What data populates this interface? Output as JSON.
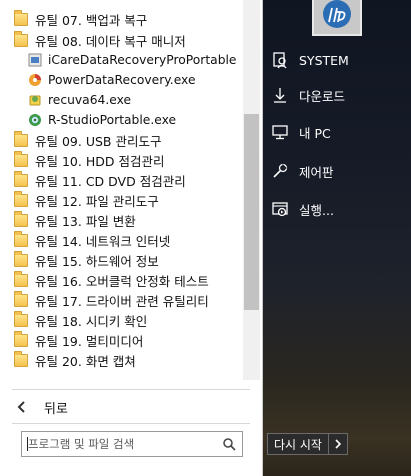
{
  "programs": [
    {
      "label": "유틸 07. 백업과 복구",
      "type": "folder"
    },
    {
      "label": "유틸 08. 데이타 복구 매니저",
      "type": "folder"
    },
    {
      "label": "iCareDataRecoveryProPortable",
      "type": "app",
      "icon": "icare-icon"
    },
    {
      "label": "PowerDataRecovery.exe",
      "type": "app",
      "icon": "powerdata-icon"
    },
    {
      "label": "recuva64.exe",
      "type": "app",
      "icon": "recuva-icon"
    },
    {
      "label": "R-StudioPortable.exe",
      "type": "app",
      "icon": "rstudio-icon"
    },
    {
      "label": "유틸 09. USB 관리도구",
      "type": "folder"
    },
    {
      "label": "유틸 10. HDD 점검관리",
      "type": "folder"
    },
    {
      "label": "유틸 11. CD DVD 점검관리",
      "type": "folder"
    },
    {
      "label": "유틸 12. 파일 관리도구",
      "type": "folder"
    },
    {
      "label": "유틸 13. 파일 변환",
      "type": "folder"
    },
    {
      "label": "유틸 14. 네트워크 인터넷",
      "type": "folder"
    },
    {
      "label": "유틸 15. 하드웨어 정보",
      "type": "folder"
    },
    {
      "label": "유틸 16. 오버클럭 안정화 테스트",
      "type": "folder"
    },
    {
      "label": "유틸 17. 드라이버 관련 유틸리티",
      "type": "folder"
    },
    {
      "label": "유틸 18. 시디키 확인",
      "type": "folder"
    },
    {
      "label": "유틸 19. 멀티미디어",
      "type": "folder"
    },
    {
      "label": "유틸 20. 화면 캡쳐",
      "type": "folder"
    }
  ],
  "back_label": "뒤로",
  "search": {
    "placeholder": "프로그램 및 파일 검색"
  },
  "right_menu": [
    {
      "label": "SYSTEM",
      "icon": "user-icon"
    },
    {
      "label": "다운로드",
      "icon": "download-icon"
    },
    {
      "label": "내 PC",
      "icon": "computer-icon"
    },
    {
      "label": "제어판",
      "icon": "wrench-icon"
    },
    {
      "label": "실행...",
      "icon": "run-icon"
    }
  ],
  "shutdown_label": "다시 시작",
  "colors": {
    "accent": "#1f6fb2",
    "folder": "#f3c24e"
  }
}
